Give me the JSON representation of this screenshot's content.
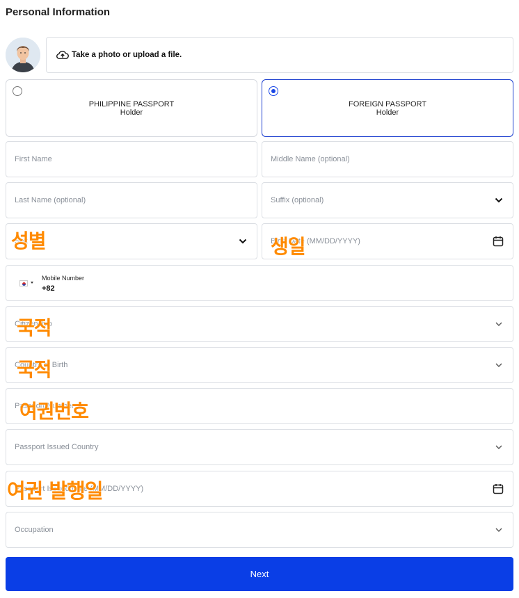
{
  "page": {
    "title": "Personal Information"
  },
  "upload": {
    "label": "Take a photo or upload a file."
  },
  "passport_type": {
    "options": [
      {
        "line1": "PHILIPPINE PASSPORT",
        "line2": "Holder",
        "selected": false
      },
      {
        "line1": "FOREIGN PASSPORT",
        "line2": "Holder",
        "selected": true
      }
    ]
  },
  "fields": {
    "first_name": "First Name",
    "middle_name": "Middle Name (optional)",
    "last_name": "Last Name (optional)",
    "suffix": "Suffix (optional)",
    "sex": "Sex",
    "birth_date": "Birth Date (MM/DD/YYYY)",
    "citizenship": "Citizenship",
    "country_of_birth": "Country of Birth",
    "passport_number": "Passport Number",
    "passport_issued_country": "Passport Issued Country",
    "passport_issued_date": "Passport Issued Date (MM/DD/YYYY)",
    "occupation": "Occupation"
  },
  "phone": {
    "label": "Mobile Number",
    "value": "+82",
    "flag": "south-korea-flag-icon"
  },
  "annotations": {
    "sex": "성별",
    "birth_date": "생일",
    "citizenship": "국적",
    "country_of_birth": "국적",
    "passport_number": "여권번호",
    "passport_issued_date": "여권 발행일"
  },
  "actions": {
    "next_label": "Next"
  },
  "colors": {
    "primary": "#0a3ee6",
    "annotation": "#ff8a00",
    "selected_border": "#1d3fcf"
  }
}
